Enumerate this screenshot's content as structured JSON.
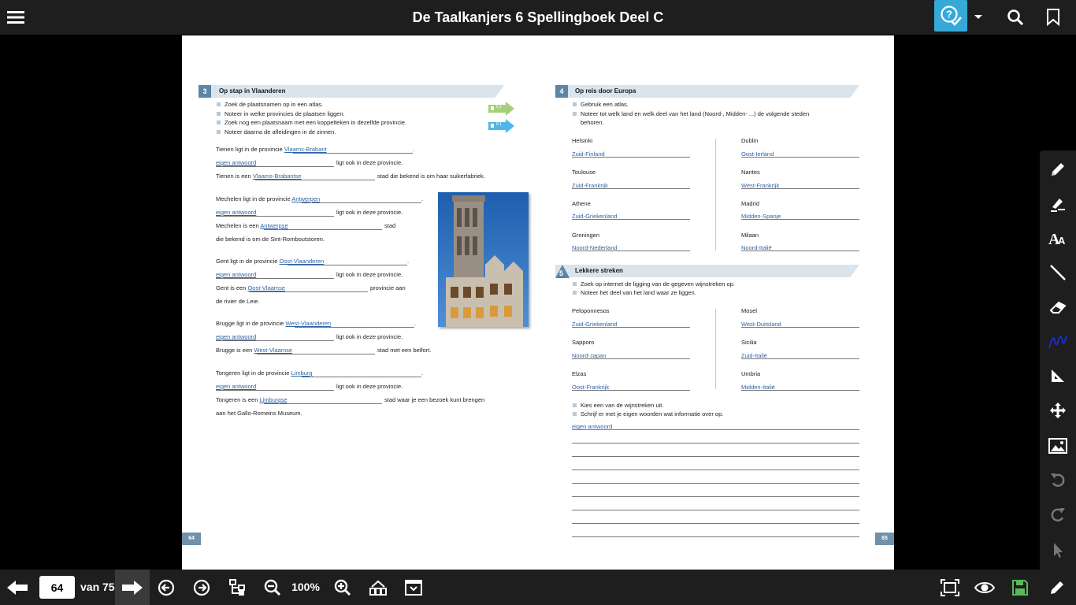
{
  "app": {
    "title": "De Taalkanjers 6 Spellingboek Deel C"
  },
  "colors": {
    "accent": "#36a9d9",
    "answer": "#2e64a8",
    "save": "#5cb85c"
  },
  "toolbar_top": {
    "icons": [
      "menu-icon",
      "help-check-icon",
      "caret-down-icon",
      "search-icon",
      "bookmark-icon"
    ]
  },
  "navigation": {
    "current_page": "64",
    "total_label": "van 75",
    "zoom": "100%"
  },
  "page_left": {
    "page_number": "64",
    "section": {
      "number": "3",
      "title": "Op stap in Vlaanderen",
      "instructions": [
        "Zoek de plaatsnamen op in een atlas.",
        "Noteer in welke provincies de plaatsen liggen.",
        "Zoek nog een plaatsnaam met een koppelteken in dezelfde provincie.",
        "Noteer daarna de afleidingen in de zinnen."
      ],
      "tags": [
        "6.1",
        "6.1"
      ]
    },
    "groups": [
      {
        "l1": "Tienen ligt in de provincie",
        "a1": "Vlaams-Brabant",
        "e1": ".",
        "a2": "eigen antwoord",
        "e2": "ligt ook in deze provincie.",
        "l3": "Tienen is een",
        "a3": "Vlaams-Brabantse",
        "e3": "stad die bekend is om haar suikerfabriek."
      },
      {
        "l1": "Mechelen ligt in de provincie",
        "a1": "Antwerpen",
        "e1": ".",
        "a2": "eigen antwoord",
        "e2": "ligt ook in deze provincie.",
        "l3": "Mechelen is een",
        "a3": "Antwerpse",
        "e3": "stad",
        "l4": "die bekend is om de Sint-Romboutstoren."
      },
      {
        "l1": "Gent ligt in de provincie",
        "a1": "Oost-Vlaanderen",
        "e1": ".",
        "a2": "eigen antwoord",
        "e2": "ligt ook in deze provincie.",
        "l3": "Gent is een",
        "a3": "Oost-Vlaamse",
        "e3": "provincie aan",
        "l4": "de rivier de Leie."
      },
      {
        "l1": "Brugge ligt in de provincie",
        "a1": "West-Vlaanderen",
        "e1": ".",
        "a2": "eigen antwoord",
        "e2": "ligt ook in deze provincie.",
        "l3": "Brugge is een",
        "a3": "West-Vlaamse",
        "e3": "stad met een belfort."
      },
      {
        "l1": "Tongeren ligt in de provincie",
        "a1": "Limburg",
        "e1": ".",
        "a2": "eigen antwoord",
        "e2": "ligt ook in deze provincie.",
        "l3": "Tongeren is een",
        "a3": "Limburgse",
        "e3": "stad waar je een bezoek kunt brengen",
        "l4": "aan het Gallo-Romeins Museum."
      }
    ]
  },
  "page_right": {
    "page_number": "65",
    "section4": {
      "number": "4",
      "title": "Op reis door Europa",
      "instructions": [
        "Gebruik een atlas.",
        "Noteer tot welk land en welk deel van het land (Noord-, Midden- ...) de volgende steden",
        "behoren."
      ],
      "left": [
        {
          "city": "Helsinki",
          "answer": "Zuid-Finland"
        },
        {
          "city": "Toulouse",
          "answer": "Zuid-Frankrijk"
        },
        {
          "city": "Athene",
          "answer": "Zuid-Griekenland"
        },
        {
          "city": "Groningen",
          "answer": "Noord-Nederland"
        }
      ],
      "right": [
        {
          "city": "Dublin",
          "answer": "Oost-Ierland"
        },
        {
          "city": "Nantes",
          "answer": "West-Frankrijk"
        },
        {
          "city": "Madrid",
          "answer": "Midden-Spanje"
        },
        {
          "city": "Milaan",
          "answer": "Noord-Italië"
        }
      ]
    },
    "section5": {
      "number": "5",
      "title": "Lekkere streken",
      "instructions": [
        "Zoek op internet de ligging van de gegeven wijnstreken op.",
        "Noteer het deel van het land waar ze liggen."
      ],
      "left": [
        {
          "city": "Peloponnesos",
          "answer": "Zuid-Griekenland"
        },
        {
          "city": "Sapporo",
          "answer": "Noord-Japan"
        },
        {
          "city": "Elzas",
          "answer": "Oost-Frankrijk"
        }
      ],
      "right": [
        {
          "city": "Mosel",
          "answer": "West-Duitsland"
        },
        {
          "city": "Sicilia",
          "answer": "Zuid-Italië"
        },
        {
          "city": "Umbria",
          "answer": "Midden-Italië"
        }
      ],
      "instructions2": [
        "Kies een van de wijnstreken uit.",
        "Schrijf er met je eigen woorden wat informatie over op."
      ],
      "free_answer": "eigen antwoord"
    }
  },
  "right_tools": [
    "pencil-icon",
    "highlighter-icon",
    "text-icon",
    "line-icon",
    "eraser-icon",
    "freehand-icon",
    "triangle-ruler-icon",
    "move-icon",
    "image-icon",
    "undo-icon",
    "redo-icon",
    "pointer-icon"
  ],
  "bottom_tools": [
    "prev-page-icon",
    "next-page-icon",
    "back-circle-icon",
    "forward-circle-icon",
    "tree-icon",
    "zoom-out-icon",
    "zoom-in-icon",
    "fit-width-icon",
    "fit-page-icon",
    "fullscreen-icon",
    "eye-icon",
    "save-icon",
    "pencil-icon"
  ]
}
